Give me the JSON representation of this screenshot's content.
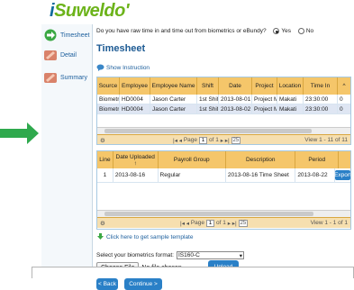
{
  "logo": {
    "prefix": "i",
    "brand": "Suweldo",
    "mark": "'"
  },
  "sidebar": {
    "items": [
      {
        "label": "Timesheet",
        "icon": "arrow-right-circle-icon"
      },
      {
        "label": "Detail",
        "icon": "pen-icon"
      },
      {
        "label": "Summary",
        "icon": "pen-icon"
      }
    ]
  },
  "question": {
    "text": "Do you have raw time in and time out from biometrics or eBundy?",
    "yes": "Yes",
    "no": "No",
    "selected": "Yes"
  },
  "page_title": "Timesheet",
  "show_instruction": "Show Instruction",
  "raw_grid": {
    "columns": [
      "Source",
      "Employee",
      "Employee Name",
      "Shift",
      "Date",
      "Project",
      "Location",
      "Time In"
    ],
    "rows": [
      [
        "Biometri",
        "HD0004",
        "Jason  Carter",
        "1st Shift",
        "2013-08-01",
        "Project M",
        "Makati",
        "23:30:00",
        "0"
      ],
      [
        "Biometri",
        "HD0004",
        "Jason  Carter",
        "1st Shift",
        "2013-08-02",
        "Project M",
        "Makati",
        "23:30:00",
        "0"
      ]
    ],
    "pager": {
      "page_label": "Page",
      "page": "1",
      "of": "of 1",
      "page_size": "25",
      "view": "View 1 - 11 of 11"
    }
  },
  "upload_grid": {
    "columns": [
      "Line",
      "Date Uploaded",
      "Payroll Group",
      "Description",
      "Period"
    ],
    "sort_glyph": "↑",
    "rows": [
      [
        "1",
        "2013-08-16",
        "Regular",
        "2013-08-16 Time Sheet",
        "2013-08-22"
      ]
    ],
    "export_label": "Export",
    "pager": {
      "page_label": "Page",
      "page": "1",
      "of": "of 1",
      "page_size": "25",
      "view": "View 1 - 1 of 1"
    }
  },
  "sample_link": "Click here to get sample template",
  "format": {
    "label": "Select your biometrics format:",
    "value": "IS160-C"
  },
  "file": {
    "button": "Choose File",
    "status": "No file chosen"
  },
  "upload_label": "Upload",
  "back_label": "< Back",
  "continue_label": "Continue >",
  "colors": {
    "brand_blue": "#0f6b9c",
    "accent_green": "#6cb31a",
    "header_orange": "#f5c66a",
    "button_blue": "#2a80c7"
  }
}
